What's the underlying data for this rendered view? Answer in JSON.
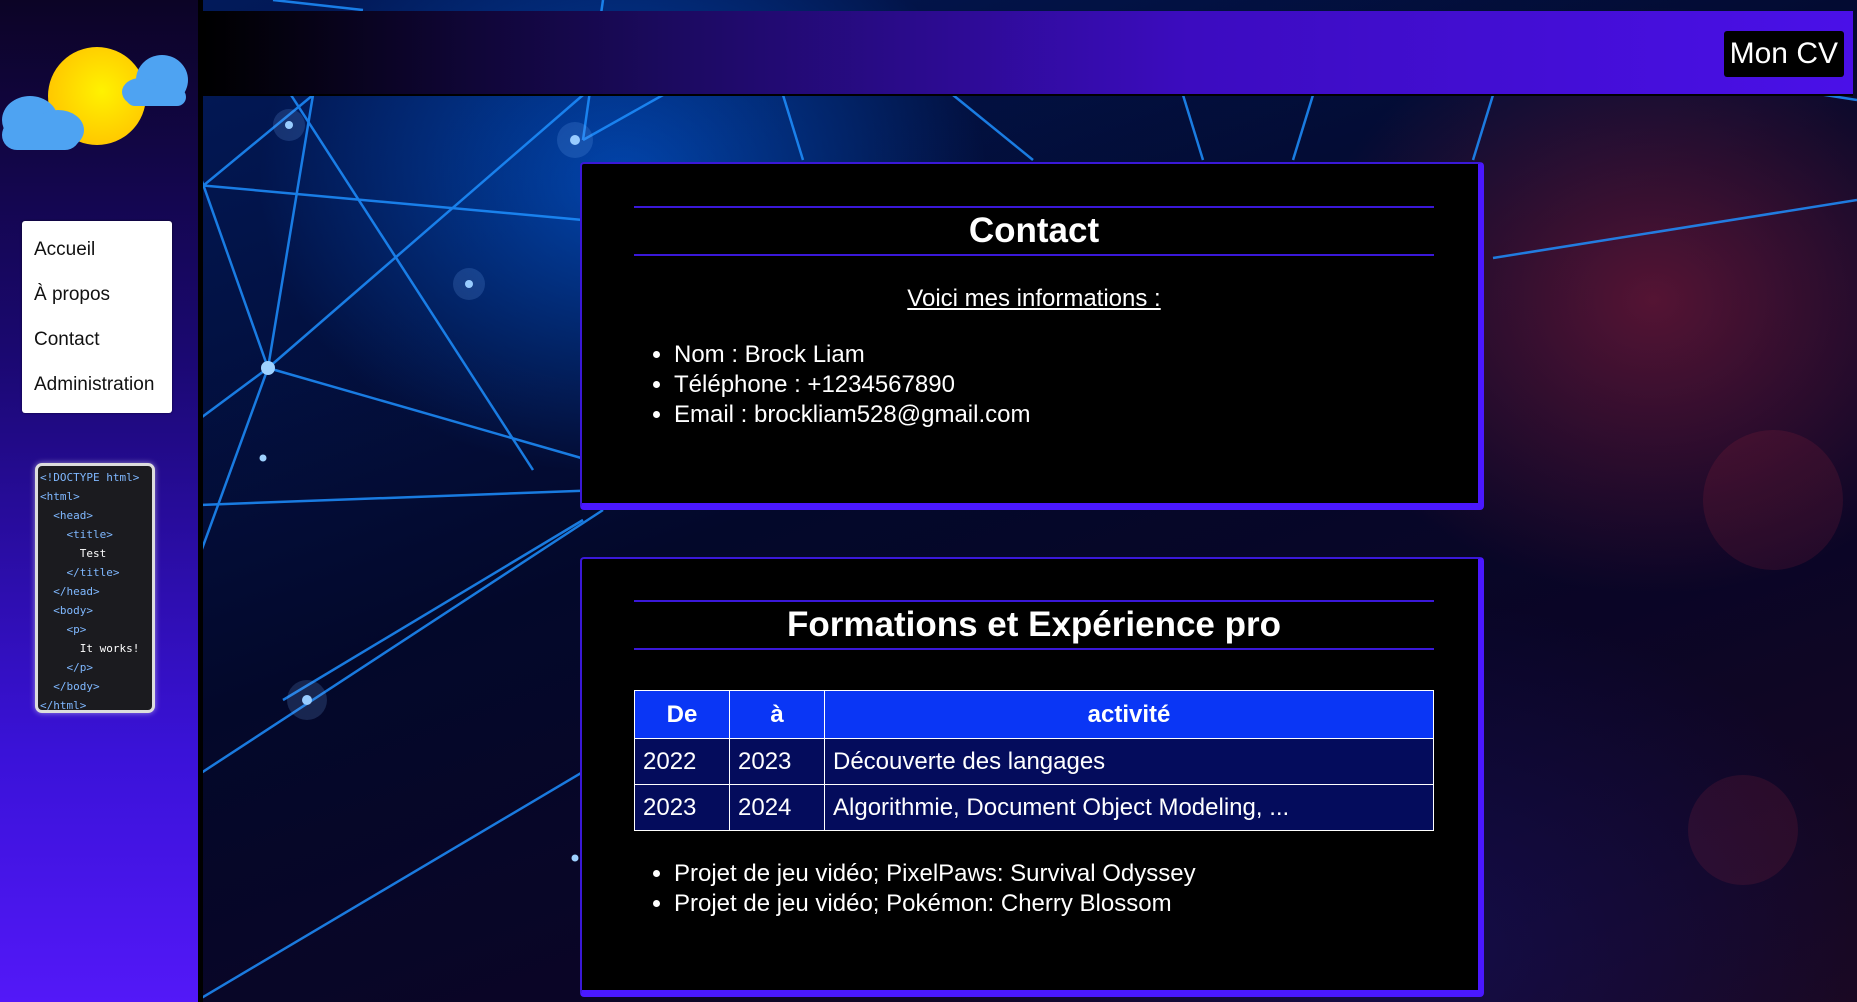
{
  "header": {
    "title": "Mon CV"
  },
  "sidebar": {
    "logo": "sun-behind-clouds-icon",
    "nav": [
      {
        "label": "Accueil"
      },
      {
        "label": "À propos"
      },
      {
        "label": "Contact"
      },
      {
        "label": "Administration"
      }
    ],
    "code_snippet": [
      "<!DOCTYPE html>",
      "<html>",
      "  <head>",
      "    <title>",
      "      Test",
      "    </title>",
      "  </head>",
      "  <body>",
      "    <p>",
      "      It works!",
      "    </p>",
      "  </body>",
      "</html>"
    ]
  },
  "contact": {
    "title": "Contact",
    "subtitle": "Voici mes informations :",
    "items": [
      "Nom : Brock Liam",
      "Téléphone : +1234567890",
      "Email : brockliam528@gmail.com"
    ]
  },
  "formations": {
    "title": "Formations et Expérience pro",
    "columns": [
      "De",
      "à",
      "activité"
    ],
    "rows": [
      [
        "2022",
        "2023",
        "Découverte des langages"
      ],
      [
        "2023",
        "2024",
        "Algorithmie, Document Object Modeling, ..."
      ]
    ],
    "projects": [
      "Projet de jeu vidéo; PixelPaws: Survival Odyssey",
      "Projet de jeu vidéo; Pokémon: Cherry Blossom"
    ]
  },
  "colors": {
    "accent": "#4a18ff",
    "table_header": "#0a36f5",
    "table_cell": "#040c5c"
  }
}
